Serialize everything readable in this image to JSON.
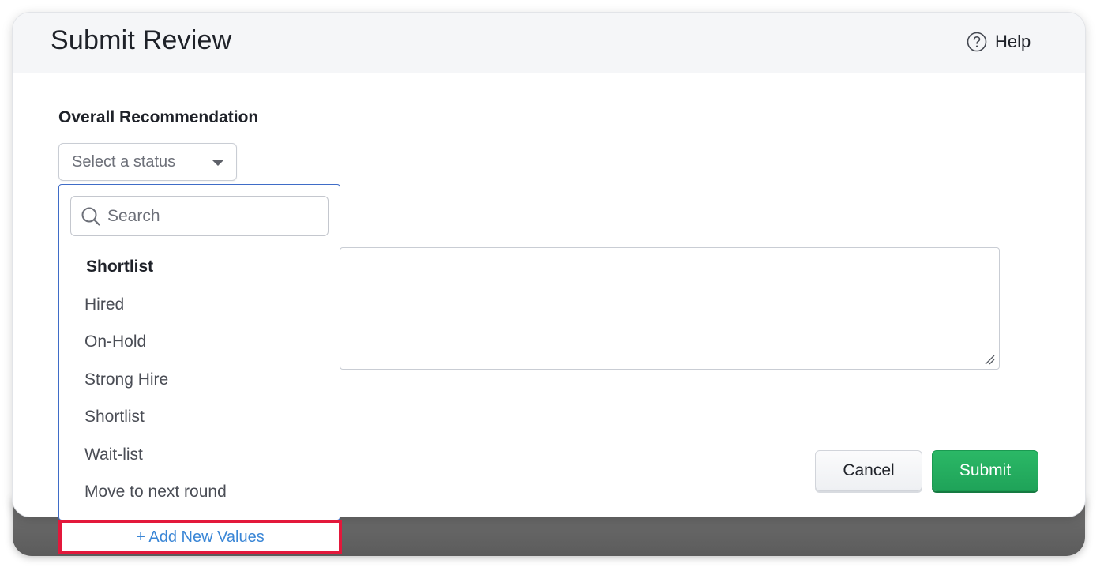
{
  "modal": {
    "title": "Submit Review",
    "help_label": "Help"
  },
  "form": {
    "recommendation_label": "Overall Recommendation",
    "status_select_value": "Select a status",
    "comment_value": ""
  },
  "dropdown": {
    "search_placeholder": "Search",
    "options": [
      "Shortlist",
      "Hired",
      "On-Hold",
      "Strong Hire",
      "Shortlist",
      "Wait-list",
      "Move to next round"
    ],
    "add_new_label": "+ Add New Values"
  },
  "buttons": {
    "cancel_label": "Cancel",
    "submit_label": "Submit"
  },
  "colors": {
    "submit_green": "#1fa359",
    "dropdown_border_blue": "#3f6cc7",
    "add_link_blue": "#3a86d6",
    "highlight_red": "#e3183b"
  },
  "icons": {
    "help": "help-circle-icon",
    "caret": "caret-down-icon",
    "search": "search-icon",
    "resize": "resize-grip-icon"
  }
}
